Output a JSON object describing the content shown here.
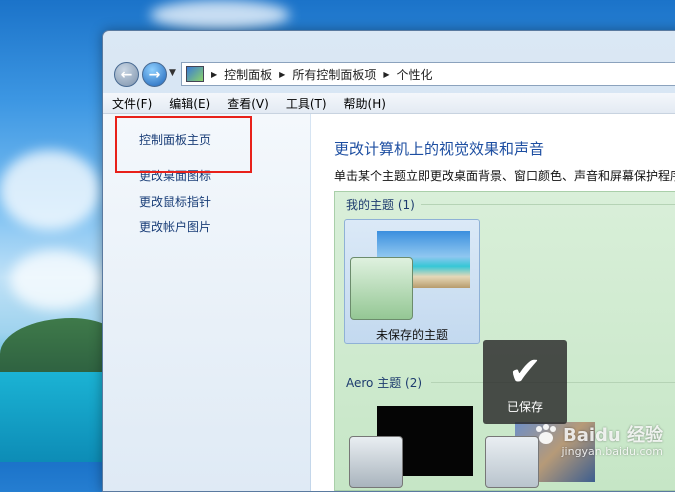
{
  "address_bar": {
    "crumbs": [
      "控制面板",
      "所有控制面板项",
      "个性化"
    ]
  },
  "menubar": {
    "items": [
      "文件(F)",
      "编辑(E)",
      "查看(V)",
      "工具(T)",
      "帮助(H)"
    ]
  },
  "left_pane": {
    "links": [
      "控制面板主页",
      "更改桌面图标",
      "更改鼠标指针",
      "更改帐户图片"
    ]
  },
  "content": {
    "title": "更改计算机上的视觉效果和声音",
    "description": "单击某个主题立即更改桌面背景、窗口颜色、声音和屏幕保护程序",
    "my_themes_header": "我的主题 (1)",
    "unsaved_theme_label": "未保存的主题",
    "aero_themes_header": "Aero 主题 (2)"
  },
  "toast": {
    "label": "已保存"
  },
  "watermark": {
    "title": "Baidu 经验",
    "url": "jingyan.baidu.com"
  },
  "colors": {
    "highlight_box": "#e8211a",
    "link": "#1a3e78",
    "title": "#1d4ea1"
  }
}
